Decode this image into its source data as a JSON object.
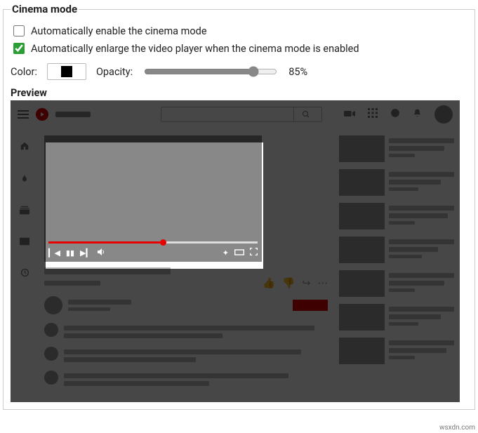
{
  "section": {
    "legend": "Cinema mode",
    "option_auto_enable": "Automatically enable the cinema mode",
    "option_auto_enlarge": "Automatically enlarge the video player when the cinema mode is enabled",
    "color_label": "Color:",
    "color_value": "#000000",
    "opacity_label": "Opacity:",
    "opacity_value": 85,
    "opacity_display": "85%",
    "preview_label": "Preview"
  },
  "checkboxes": {
    "auto_enable": false,
    "auto_enlarge": true
  },
  "watermark": "wsxdn.com"
}
